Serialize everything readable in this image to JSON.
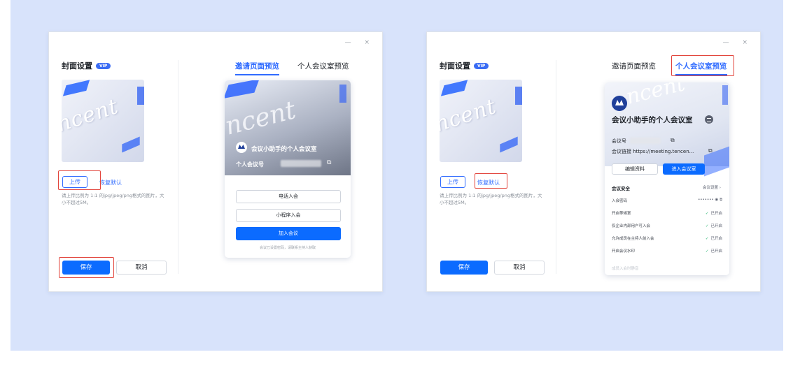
{
  "window_controls": "— ×",
  "panel_left": {
    "title": "封面设置",
    "vip": "VIP",
    "cover_text": "ncent",
    "upload": "上传",
    "restore": "恢复默认",
    "hint": "请上传比例为 1:1 的jpg/jpeg/png格式的图片，大小不超过5M。",
    "save": "保存",
    "cancel": "取消"
  },
  "tabs": {
    "invite": "邀请页面预览",
    "room": "个人会议室预览"
  },
  "invite_card": {
    "cover_text": "ncent",
    "room_name": "会议小助手的个人会议室",
    "meeting_id_label": "个人会议号",
    "copy_icon": "⧉",
    "phone_join": "电话入会",
    "miniprogram_join": "小程序入会",
    "join": "加入会议",
    "footer": "会议已设置密码，请联系主持人获取"
  },
  "room_card": {
    "cover_text": "ncent",
    "room_name": "会议小助手的个人会议室",
    "meeting_id_label": "会议号",
    "link_label": "会议链接",
    "link_value": "https://meeting.tencen...",
    "copy_icon": "⧉",
    "edit": "编辑资料",
    "enter": "进入会议室",
    "security_title": "会议安全",
    "settings_link": "会议设置 ›",
    "items": [
      {
        "label": "入会密码",
        "value": "•••••••  ◉  ⧉",
        "check": ""
      },
      {
        "label": "开启等候室",
        "value": "已开启",
        "check": "✓"
      },
      {
        "label": "仅企业内部用户可入会",
        "value": "已开启",
        "check": "✓"
      },
      {
        "label": "允许成员在主持人前入会",
        "value": "已开启",
        "check": "✓"
      },
      {
        "label": "开启会议水印",
        "value": "已开启",
        "check": "✓"
      }
    ],
    "faded": "成员入会时静音"
  },
  "colors": {
    "accent": "#0b6bff",
    "highlight": "#e2453c",
    "background": "#d8e3fb"
  }
}
